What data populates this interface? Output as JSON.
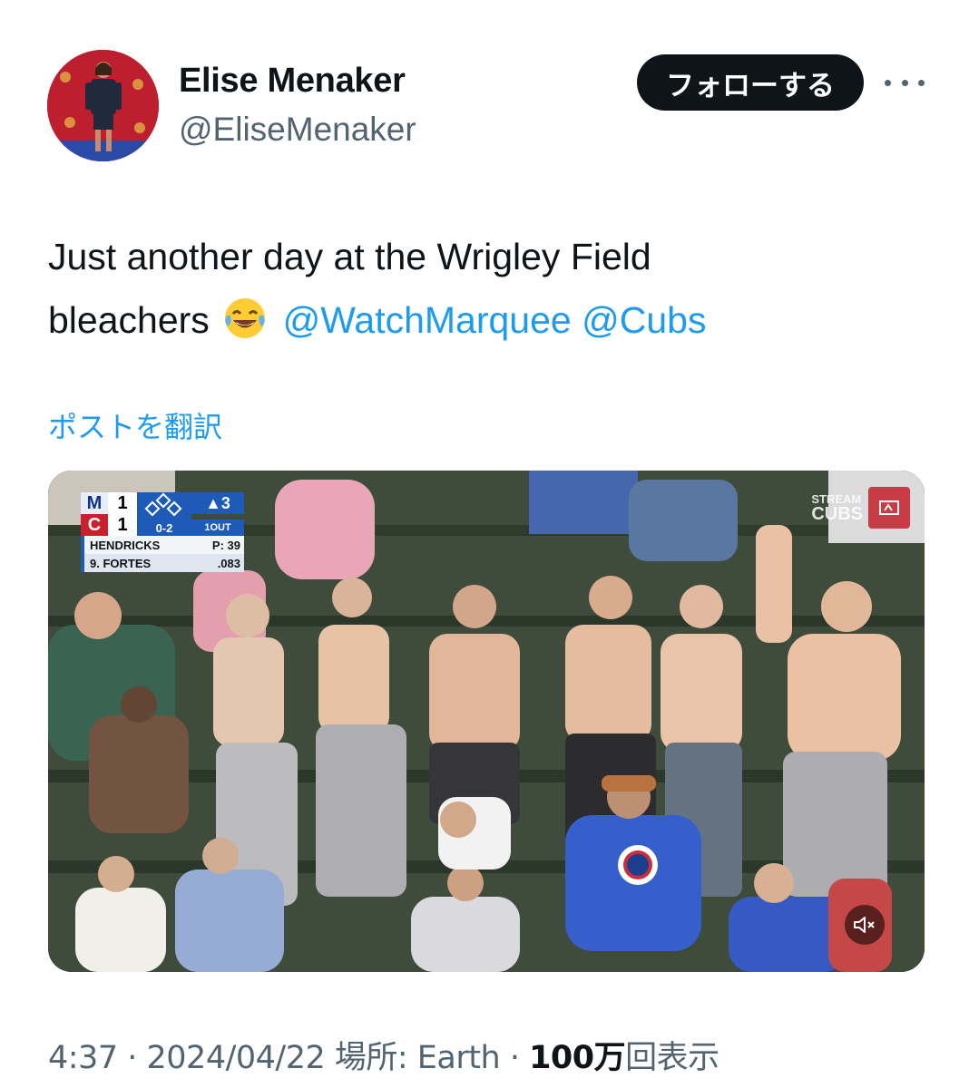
{
  "author": {
    "display_name": "Elise Menaker",
    "handle": "@EliseMenaker",
    "avatar_icon": "profile-photo"
  },
  "header": {
    "follow_label": "フォローする",
    "more_icon": "more-horizontal-icon"
  },
  "tweet": {
    "text_line1": "Just another day at the Wrigley Field",
    "text_line2": "bleachers",
    "emoji": "face-with-tears-of-joy",
    "mention_1": "@WatchMarquee",
    "mention_2": "@Cubs",
    "translate_label": "ポストを翻訳"
  },
  "video": {
    "scorebug": {
      "away_team": "M",
      "away_score": "1",
      "home_team": "C",
      "home_score": "1",
      "inning": "▲3",
      "count": "0-2",
      "outs": "1OUT",
      "pitcher": "HENDRICKS",
      "pitch_count": "P: 39",
      "batter": "9. FORTES",
      "batter_avg": ".083"
    },
    "stream_label_top": "STREAM",
    "stream_label_bottom": "CUBS",
    "mute_icon": "volume-muted-icon"
  },
  "meta": {
    "time": "4:37",
    "date": "2024/04/22",
    "location": "場所: Earth",
    "views_count": "100万",
    "views_label": "回表示"
  },
  "colors": {
    "accent": "#1d9bf0",
    "text_primary": "#0f1419",
    "text_secondary": "#536471",
    "follow_bg": "#0f1419"
  }
}
